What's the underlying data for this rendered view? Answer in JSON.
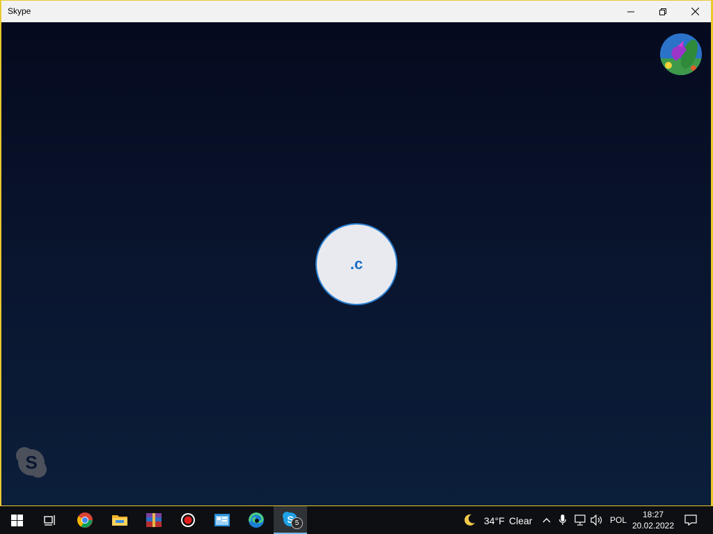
{
  "window": {
    "title": "Skype",
    "controls": {
      "minimize": "minimize-icon",
      "maximize": "restore-icon",
      "close": "close-icon"
    }
  },
  "main": {
    "loading_text": ".c",
    "colors": {
      "background_top": "#050a1e",
      "background_bottom": "#0b1e3a",
      "accent": "#2a7fd0"
    }
  },
  "taskbar": {
    "apps": [
      {
        "name": "start",
        "icon": "windows-icon"
      },
      {
        "name": "task-view",
        "icon": "task-view-icon"
      },
      {
        "name": "chrome",
        "icon": "chrome-icon"
      },
      {
        "name": "file-explorer",
        "icon": "folder-icon"
      },
      {
        "name": "winrar",
        "icon": "winrar-icon"
      },
      {
        "name": "recorder",
        "icon": "record-icon"
      },
      {
        "name": "app",
        "icon": "app-window-icon"
      },
      {
        "name": "edge",
        "icon": "edge-icon"
      },
      {
        "name": "skype",
        "icon": "skype-icon",
        "active": true,
        "badge": "5"
      }
    ],
    "weather": {
      "temp": "34°F",
      "condition": "Clear",
      "icon": "moon-icon"
    },
    "tray_icons": [
      "chevron-up-icon",
      "microphone-icon",
      "network-icon",
      "speaker-icon"
    ],
    "language": "POL",
    "time": "18:27",
    "date": "20.02.2022",
    "notification_icon": "notification-icon"
  }
}
